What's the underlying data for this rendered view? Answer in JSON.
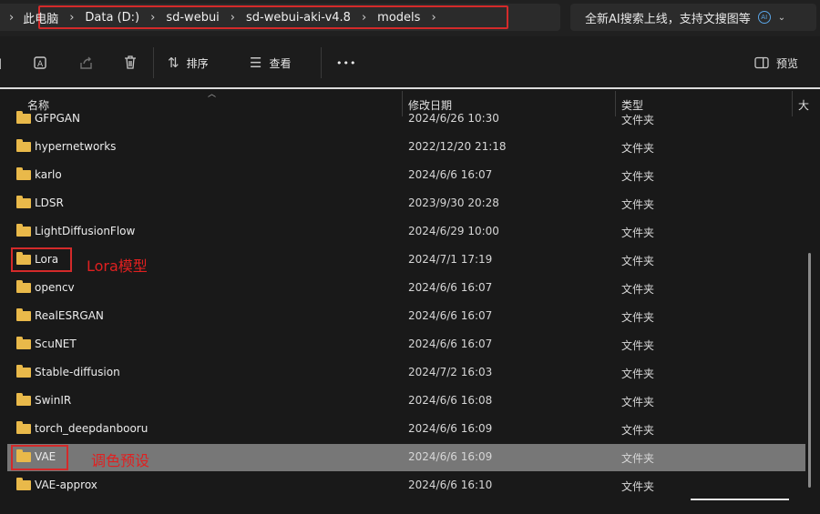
{
  "breadcrumb": [
    "此电脑",
    "Data (D:)",
    "sd-webui",
    "sd-webui-aki-v4.8",
    "models"
  ],
  "search": {
    "text": "全新AI搜索上线，支持文搜图等"
  },
  "toolbar": {
    "sort_label": "排序",
    "view_label": "查看",
    "more_label": "•••",
    "preview_label": "预览"
  },
  "columns": {
    "name": "名称",
    "date": "修改日期",
    "type": "类型",
    "extra": "大"
  },
  "rows": [
    {
      "name": "GFPGAN",
      "date": "2024/6/26 10:30",
      "type": "文件夹"
    },
    {
      "name": "hypernetworks",
      "date": "2022/12/20 21:18",
      "type": "文件夹"
    },
    {
      "name": "karlo",
      "date": "2024/6/6 16:07",
      "type": "文件夹"
    },
    {
      "name": "LDSR",
      "date": "2023/9/30 20:28",
      "type": "文件夹"
    },
    {
      "name": "LightDiffusionFlow",
      "date": "2024/6/29 10:00",
      "type": "文件夹"
    },
    {
      "name": "Lora",
      "date": "2024/7/1 17:19",
      "type": "文件夹"
    },
    {
      "name": "opencv",
      "date": "2024/6/6 16:07",
      "type": "文件夹"
    },
    {
      "name": "RealESRGAN",
      "date": "2024/6/6 16:07",
      "type": "文件夹"
    },
    {
      "name": "ScuNET",
      "date": "2024/6/6 16:07",
      "type": "文件夹"
    },
    {
      "name": "Stable-diffusion",
      "date": "2024/7/2 16:03",
      "type": "文件夹"
    },
    {
      "name": "SwinIR",
      "date": "2024/6/6 16:08",
      "type": "文件夹"
    },
    {
      "name": "torch_deepdanbooru",
      "date": "2024/6/6 16:09",
      "type": "文件夹"
    },
    {
      "name": "VAE",
      "date": "2024/6/6 16:09",
      "type": "文件夹",
      "selected": true
    },
    {
      "name": "VAE-approx",
      "date": "2024/6/6 16:10",
      "type": "文件夹"
    }
  ],
  "annotations": {
    "lora": "Lora模型",
    "vae": "调色预设"
  }
}
